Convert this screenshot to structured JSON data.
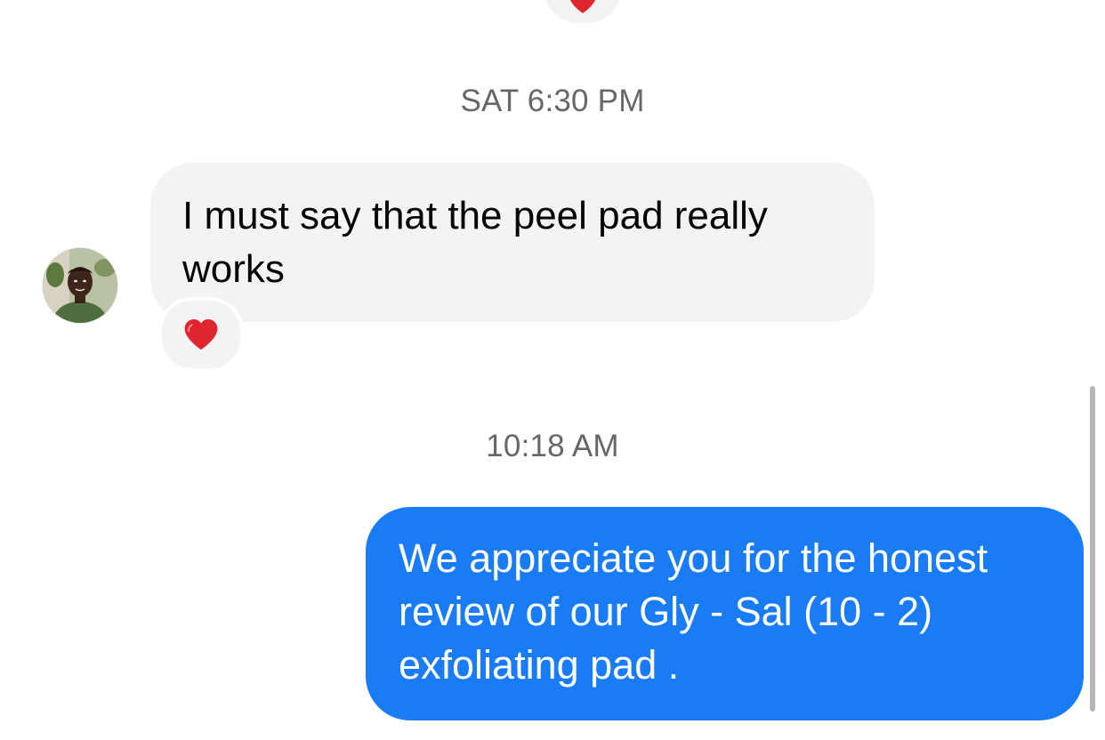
{
  "thread": {
    "timestamps": [
      "SAT 6:30 PM",
      "10:18 AM"
    ],
    "messages": [
      {
        "direction": "incoming",
        "text": "I must say that the peel pad really works",
        "reaction": "❤️",
        "sender_avatar": "avatar-photo"
      },
      {
        "direction": "outgoing",
        "text": "We appreciate you for the honest review of our Gly - Sal (10 - 2) exfoliating pad ."
      }
    ],
    "previous_reaction": "❤️"
  },
  "colors": {
    "incoming_bubble": "#f2f3f5",
    "outgoing_bubble": "#1a7cf5",
    "timestamp_text": "#65676b",
    "heart": "#e0252f"
  },
  "icons": {
    "reaction": "heart-icon"
  }
}
